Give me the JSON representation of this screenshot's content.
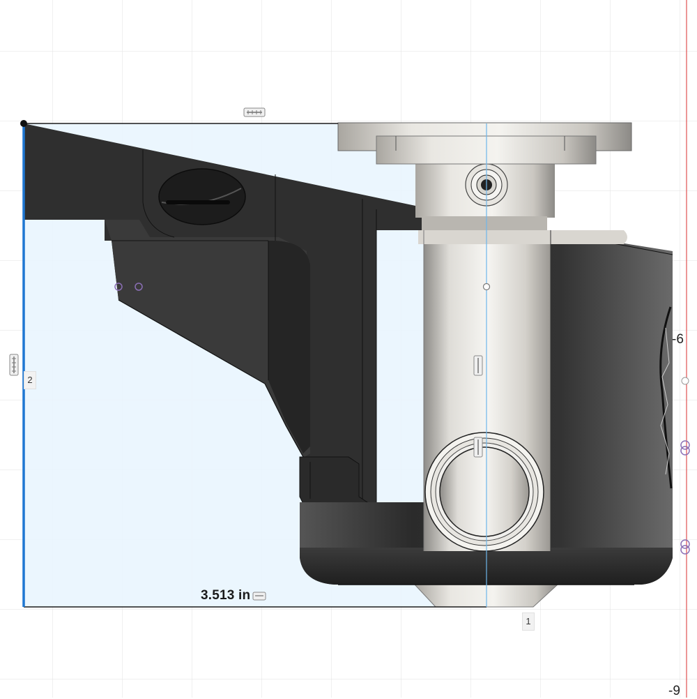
{
  "dimension": {
    "value": "3.513 in"
  },
  "sketch_points": {
    "point_1": "1",
    "point_2": "2"
  },
  "ruler_labels": {
    "right_upper": "-6",
    "right_lower": "-9"
  },
  "colors": {
    "grid": "#e6e6e6",
    "grid_major": "#d8d8d8",
    "sketch_profile_fill": "#e8f4fd",
    "sketch_line": "#1e77d2",
    "body_dark": "#2e2e2e",
    "metal": "#d6d3cc",
    "red_axis": "#e05050"
  },
  "icons": [
    "dimension-constraint-icon",
    "horizontal-constraint-icon",
    "vertical-constraint-icon"
  ]
}
